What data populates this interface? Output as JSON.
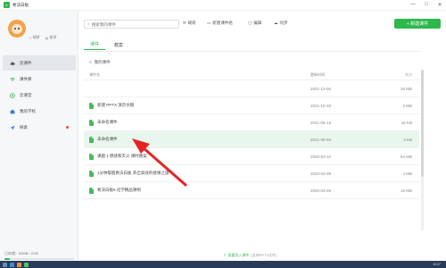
{
  "window": {
    "title": "希沃白板",
    "controls": [
      "—",
      "□",
      "✕"
    ]
  },
  "user": {
    "name": "胡学",
    "school": "化学"
  },
  "sidebar": {
    "items": [
      {
        "label": "云课件",
        "icon": "cloud-icon",
        "active": true
      },
      {
        "label": "课件库",
        "icon": "wifi-icon"
      },
      {
        "label": "云课堂",
        "icon": "play-circle-icon"
      },
      {
        "label": "我的学校",
        "icon": "school-icon"
      },
      {
        "label": "探索",
        "icon": "send-icon",
        "badge": true
      }
    ],
    "storage": "已存储：83MB / 2GB"
  },
  "toolbar": {
    "search_placeholder": "搜索我的课件",
    "refresh_label": "刷新",
    "new_folder_label": "新建课件组",
    "edit_label": "编辑",
    "sync_label": "同步",
    "new_courseware_label": "+ 新建课件"
  },
  "tabs": [
    {
      "label": "课件",
      "active": true
    },
    {
      "label": "教案"
    }
  ],
  "breadcrumb": {
    "back": "<",
    "path": "我的课件"
  },
  "table": {
    "headers": {
      "name": "课件名",
      "date": "更新时间",
      "size": "大小"
    },
    "rows": [
      {
        "name": "",
        "date": "2021-12-06",
        "size": "20 MB",
        "type": "folder"
      },
      {
        "name": "新建 PPTX 演示文稿",
        "date": "2021-10-19",
        "size": "2 MB"
      },
      {
        "name": "未命名课件",
        "date": "2021-08-13",
        "size": "16 KB"
      },
      {
        "name": "未命名课件",
        "date": "2021-08-03",
        "size": "3 KB",
        "highlight": true
      },
      {
        "name": "课题 1 燃烧和灭火 课时教案",
        "date": "2020-03-10",
        "size": "54 MB"
      },
      {
        "name": "1分钟掌握希沃白板 开启高效的授课之旅",
        "date": "2020-03-09",
        "size": "4 MB"
      },
      {
        "name": "希沃白板5 化学精品课例",
        "date": "2020-03-09",
        "size": "18 MB"
      }
    ]
  },
  "footer": {
    "link": "批量导入课件",
    "hint": "(支持PPTX文件)"
  },
  "taskbar": {
    "clock": "10:27"
  },
  "colors": {
    "accent": "#2db84c",
    "arrow": "#e52323"
  }
}
